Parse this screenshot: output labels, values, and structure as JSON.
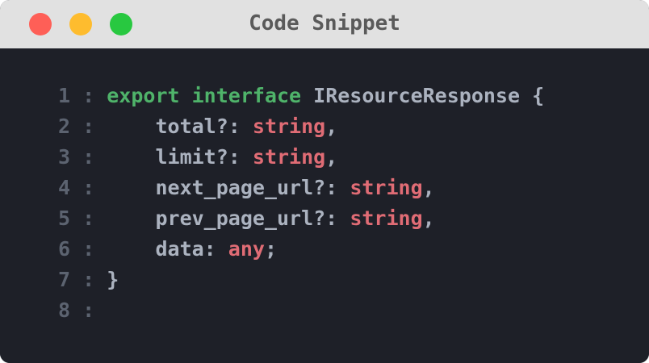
{
  "window": {
    "title": "Code Snippet"
  },
  "colors": {
    "keyword": "#4fb36a",
    "type": "#e06c75",
    "text": "#abb2bf",
    "line_number": "#5c6370",
    "editor_bg": "#1e2028",
    "titlebar_bg": "#e1e1e1"
  },
  "code": {
    "separator": ":",
    "lines": [
      {
        "num": "1",
        "indent": "",
        "kw1": "export",
        "kw2": "interface",
        "name": "IResourceResponse",
        "brace": "{"
      },
      {
        "num": "2",
        "indent": "    ",
        "prop": "total?:",
        "type": "string",
        "punct": ","
      },
      {
        "num": "3",
        "indent": "    ",
        "prop": "limit?:",
        "type": "string",
        "punct": ","
      },
      {
        "num": "4",
        "indent": "    ",
        "prop": "next_page_url?:",
        "type": "string",
        "punct": ","
      },
      {
        "num": "5",
        "indent": "    ",
        "prop": "prev_page_url?:",
        "type": "string",
        "punct": ","
      },
      {
        "num": "6",
        "indent": "    ",
        "prop": "data:",
        "type": "any",
        "punct": ";"
      },
      {
        "num": "7",
        "indent": "",
        "text": "}"
      },
      {
        "num": "8",
        "indent": "",
        "text": ""
      }
    ]
  }
}
